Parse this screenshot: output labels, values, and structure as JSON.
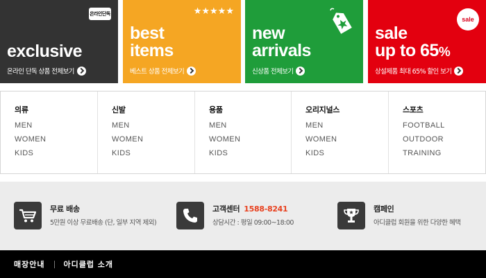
{
  "banners": [
    {
      "id": "exclusive",
      "bg": "#333333",
      "title_line1": "exclusive",
      "title_line2": "",
      "subtitle": "온라인 단독 상품 전체보기",
      "badge": "온라인단독",
      "icon": "online-exclusive-badge-icon"
    },
    {
      "id": "best-items",
      "bg": "#f5a623",
      "title_line1": "best",
      "title_line2": "items",
      "subtitle": "베스트 상품 전체보기",
      "badge": "★★★★★",
      "icon": "five-stars-icon"
    },
    {
      "id": "new-arrivals",
      "bg": "#1f9d3a",
      "title_line1": "new",
      "title_line2": "arrivals",
      "subtitle": "신상품 전체보기",
      "badge": "",
      "icon": "price-tag-icon"
    },
    {
      "id": "sale",
      "bg": "#e3000f",
      "title_line1": "sale",
      "title_line2": "up to 65",
      "title_pct": "%",
      "subtitle": "상설제품 최대 65% 할인 보기",
      "badge": "sale",
      "icon": "sale-circle-icon"
    }
  ],
  "categories": [
    {
      "title": "의류",
      "links": [
        "MEN",
        "WOMEN",
        "KIDS"
      ]
    },
    {
      "title": "신발",
      "links": [
        "MEN",
        "WOMEN",
        "KIDS"
      ]
    },
    {
      "title": "용품",
      "links": [
        "MEN",
        "WOMEN",
        "KIDS"
      ]
    },
    {
      "title": "오리지널스",
      "links": [
        "MEN",
        "WOMEN",
        "KIDS"
      ]
    },
    {
      "title": "스포츠",
      "links": [
        "FOOTBALL",
        "OUTDOOR",
        "TRAINING"
      ]
    }
  ],
  "info": [
    {
      "icon": "shopping-cart-icon",
      "title": "무료 배송",
      "phone": "",
      "desc": "5만원 이상 무료배송 (단, 일부 지역 제외)"
    },
    {
      "icon": "phone-icon",
      "title": "고객센터",
      "phone": "1588-8241",
      "desc": "상담시간 : 평일 09:00~18:00"
    },
    {
      "icon": "trophy-icon",
      "title": "캠페인",
      "phone": "",
      "desc": "아디클럽 회원을 위한 다양한 혜택"
    }
  ],
  "footer": {
    "link1": "매장안내",
    "link2": "아디클럽 소개",
    "bg": "#000000"
  },
  "colors": {
    "accent_phone": "#e8411f",
    "info_bg": "#ececec"
  }
}
